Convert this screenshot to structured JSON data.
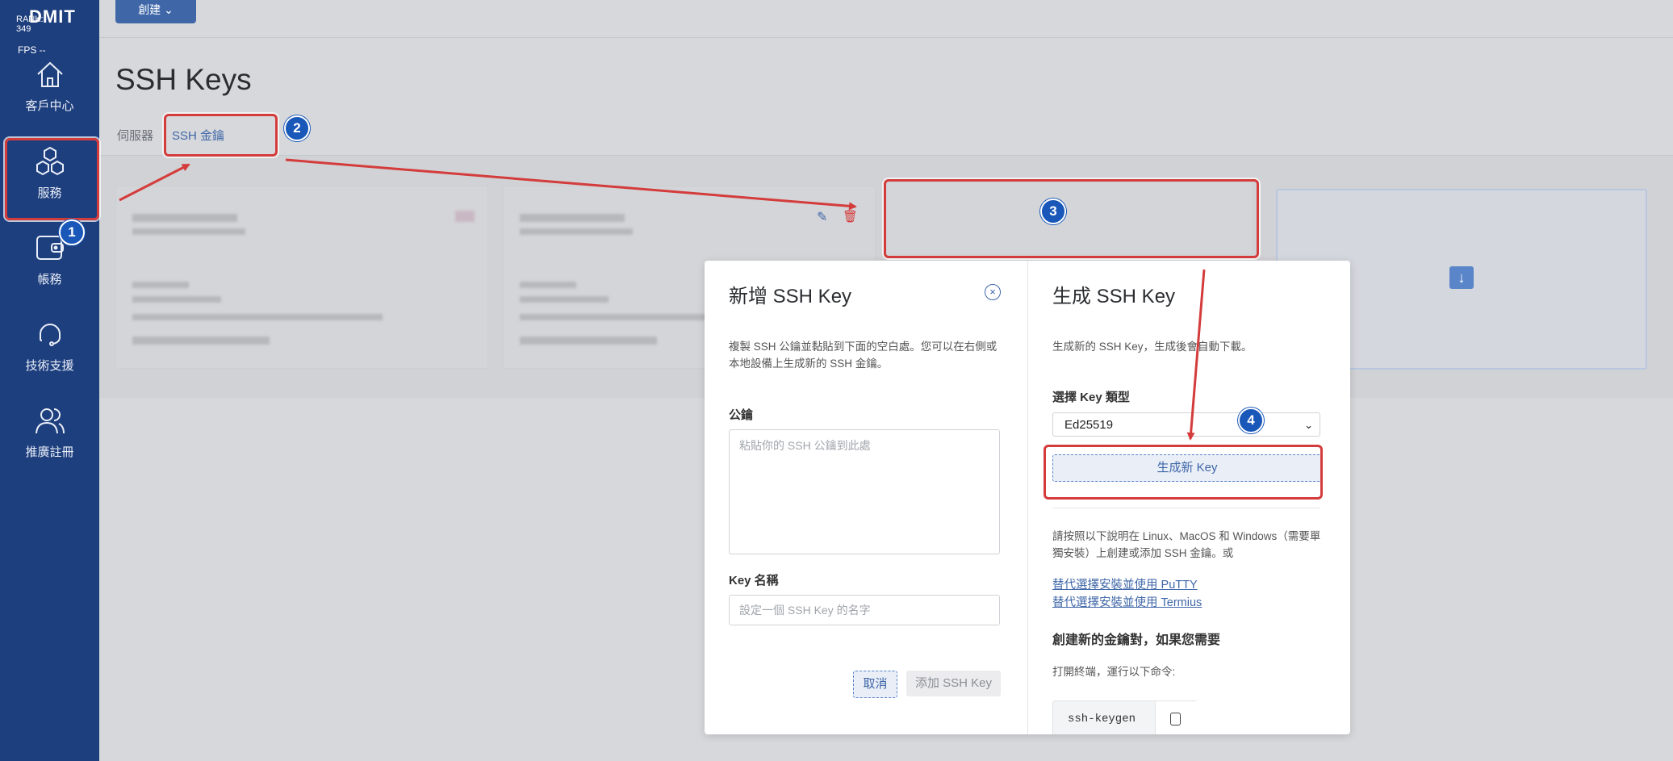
{
  "app": {
    "logo_text": "DMIT",
    "rank_text": "RANK: 349",
    "fps_text": "FPS --"
  },
  "sidebar": {
    "items": [
      {
        "label": "客戶中心",
        "icon": "home-icon"
      },
      {
        "label": "服務",
        "icon": "cubes-icon"
      },
      {
        "label": "帳務",
        "icon": "wallet-icon"
      },
      {
        "label": "技術支援",
        "icon": "headset-icon"
      },
      {
        "label": "推廣註冊",
        "icon": "users-icon"
      }
    ]
  },
  "topbar": {
    "create_label": "創建",
    "create_icon": "chevron-down-icon"
  },
  "page": {
    "title": "SSH Keys",
    "tabs": [
      {
        "label": "伺服器"
      },
      {
        "label": "SSH 金鑰"
      }
    ]
  },
  "add_modal": {
    "title": "新增 SSH Key",
    "description": "複製 SSH 公鑰並黏貼到下面的空白處。您可以在右側或本地設備上生成新的 SSH 金鑰。",
    "pubkey_label": "公鑰",
    "pubkey_placeholder": "粘貼你的 SSH 公鑰到此處",
    "keyname_label": "Key 名稱",
    "keyname_placeholder": "設定一個 SSH Key 的名字",
    "cancel_label": "取消",
    "submit_label": "添加 SSH Key"
  },
  "generate_panel": {
    "title": "生成 SSH Key",
    "description": "生成新的 SSH Key，生成後會自動下載。",
    "keytype_label": "選擇 Key 類型",
    "keytype_value": "Ed25519",
    "generate_label": "生成新 Key",
    "instructions": "請按照以下說明在 Linux、MacOS 和 Windows（需要單獨安裝）上創建或添加 SSH 金鑰。或",
    "link_putty": "替代選擇安裝並使用 PuTTY",
    "link_termius": "替代選擇安裝並使用 Termius",
    "create_heading": "創建新的金鑰對，如果您需要",
    "terminal_text": "打開終端，運行以下命令:",
    "command": "ssh-keygen"
  },
  "annotations": {
    "badges": [
      "1",
      "2",
      "3",
      "4"
    ]
  },
  "colors": {
    "sidebar": "#1e3f7e",
    "accent": "#3f67a8",
    "annotation_red": "#d43c3c",
    "badge_blue": "#1957b8"
  }
}
